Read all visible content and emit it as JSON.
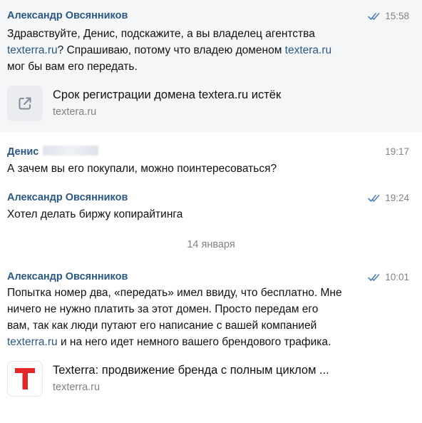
{
  "messages": [
    {
      "author": "Александр Овсянников",
      "time": "15:58",
      "status_icon": "double-check-icon",
      "lines": [
        [
          "Здравствуйте, Денис, подскажите, а вы владелец агентства"
        ],
        [
          "texterra.ru",
          "? Спрашиваю, потому что владею доменом ",
          "textera.ru"
        ],
        [
          "мог бы вам его передать."
        ]
      ],
      "snippet": {
        "icon": "external-link-icon",
        "title": "Срок регистрации домена textera.ru истёк",
        "domain": "textera.ru"
      }
    },
    {
      "author": "Денис",
      "time": "19:17",
      "lines": [
        [
          "А зачем вы его покупали, можно поинтересоваться?"
        ]
      ]
    },
    {
      "author": "Александр Овсянников",
      "time": "19:24",
      "status_icon": "double-check-icon",
      "lines": [
        [
          "Хотел делать биржу копирайтинга"
        ]
      ]
    },
    {
      "author": "Александр Овсянников",
      "time": "10:01",
      "status_icon": "double-check-icon",
      "lines": [
        [
          "Попытка номер два, «передать» имел ввиду, что бесплатно. Мне"
        ],
        [
          "ничего не нужно платить за этот домен. Просто передам его"
        ],
        [
          "вам, так как люди путают его написание с вашей компанией"
        ],
        [
          "texterra.ru",
          " и на него идет немного вашего брендового трафика."
        ]
      ],
      "snippet": {
        "icon": "texterra-logo-icon",
        "logo_letter": "T",
        "title": "Texterra: продвижение бренда с полным циклом ...",
        "domain": "texterra.ru"
      }
    }
  ],
  "date_separator": "14 января",
  "colors": {
    "author": "#2a5885",
    "link": "#2a5885",
    "meta": "#828282",
    "highlight_bg": "#f5f6f8",
    "logo_red": "#e52628"
  }
}
